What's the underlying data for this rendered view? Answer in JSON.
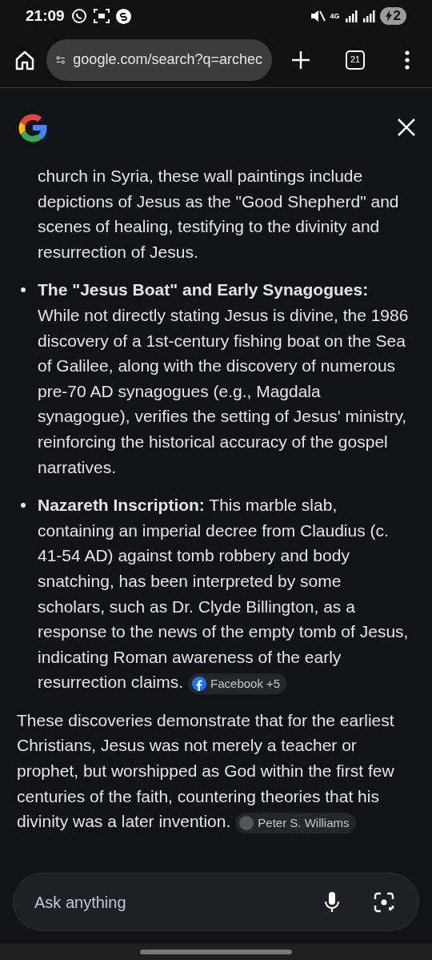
{
  "status_bar": {
    "time": "21:09",
    "network": "4G",
    "battery": "2"
  },
  "toolbar": {
    "url": "google.com/search?q=archec",
    "tab_count": "21"
  },
  "answer": {
    "continued_text": "church in Syria, these wall paintings include depictions of Jesus as the \"Good Shepherd\" and scenes of healing, testifying to the divinity and resurrection of Jesus.",
    "bullets": [
      {
        "text": "**The \"Jesus Boat\" and Early Synagogues:** While not directly stating Jesus is divine, the 1986 discovery of a 1st-century fishing boat on the Sea of Galilee, along with the discovery of numerous pre-70 AD synagogues (e.g., Magdala synagogue), verifies the setting of Jesus' ministry, reinforcing the historical accuracy of the gospel narratives."
      },
      {
        "text": "**Nazareth Inscription:** This marble slab, containing an imperial decree from Claudius (c. 41-54 AD) against tomb robbery and body snatching, has been interpreted by some scholars, such as Dr. Clyde Billington, as a response to the news of the empty tomb of Jesus, indicating Roman awareness of the early resurrection claims.",
        "source": {
          "kind": "facebook",
          "label": "Facebook +5"
        }
      }
    ],
    "conclusion": {
      "text": "These discoveries demonstrate that for the earliest Christians, Jesus was not merely a teacher or prophet, but worshipped as God within the first few centuries of the faith, countering theories that his divinity was a later invention.",
      "source": {
        "kind": "initials",
        "label": "Peter S. Williams"
      }
    }
  },
  "ask_bar": {
    "placeholder": "Ask anything"
  }
}
